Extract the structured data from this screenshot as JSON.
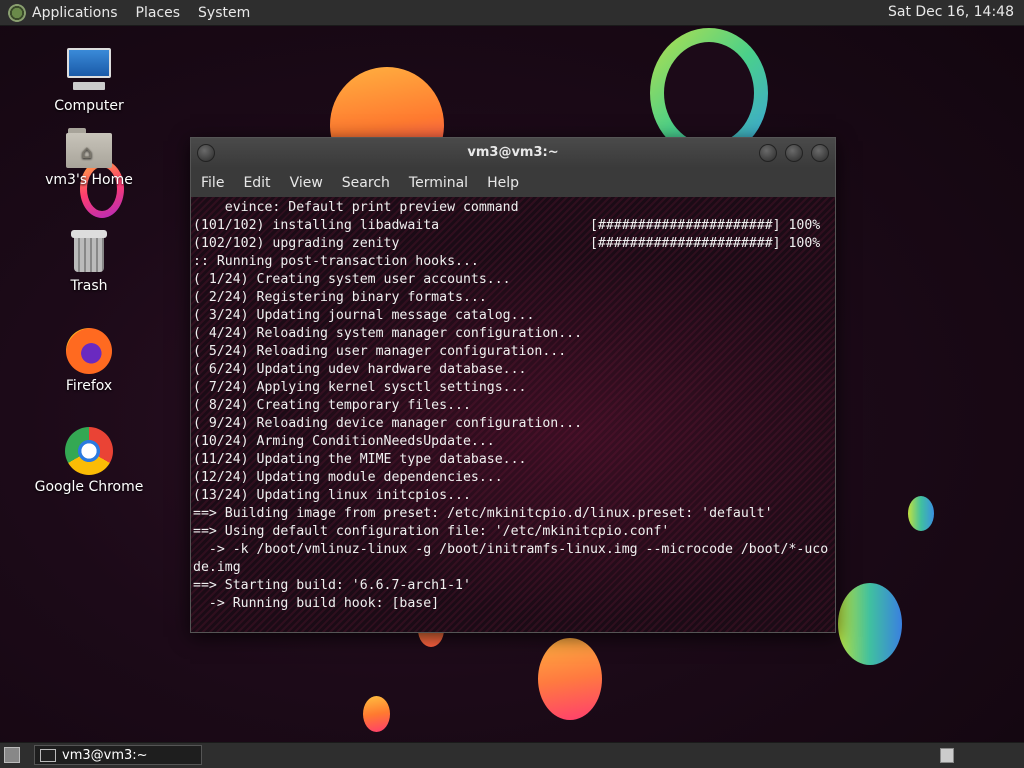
{
  "top_panel": {
    "menus": [
      "Applications",
      "Places",
      "System"
    ],
    "clock": "Sat Dec 16, 14:48"
  },
  "desktop_icons": [
    {
      "label": "Computer",
      "icon": "computer-icon"
    },
    {
      "label": "vm3's Home",
      "icon": "home-folder-icon"
    },
    {
      "label": "Trash",
      "icon": "trash-icon"
    },
    {
      "label": "Firefox",
      "icon": "firefox-icon"
    },
    {
      "label": "Google Chrome",
      "icon": "chrome-icon"
    }
  ],
  "terminal": {
    "title": "vm3@vm3:~",
    "menu": [
      "File",
      "Edit",
      "View",
      "Search",
      "Terminal",
      "Help"
    ],
    "lines": [
      "    evince: Default print preview command",
      "(101/102) installing libadwaita                   [######################] 100%",
      "(102/102) upgrading zenity                        [######################] 100%",
      ":: Running post-transaction hooks...",
      "( 1/24) Creating system user accounts...",
      "( 2/24) Registering binary formats...",
      "( 3/24) Updating journal message catalog...",
      "( 4/24) Reloading system manager configuration...",
      "( 5/24) Reloading user manager configuration...",
      "( 6/24) Updating udev hardware database...",
      "( 7/24) Applying kernel sysctl settings...",
      "( 8/24) Creating temporary files...",
      "( 9/24) Reloading device manager configuration...",
      "(10/24) Arming ConditionNeedsUpdate...",
      "(11/24) Updating the MIME type database...",
      "(12/24) Updating module dependencies...",
      "(13/24) Updating linux initcpios...",
      "==> Building image from preset: /etc/mkinitcpio.d/linux.preset: 'default'",
      "==> Using default configuration file: '/etc/mkinitcpio.conf'",
      "  -> -k /boot/vmlinuz-linux -g /boot/initramfs-linux.img --microcode /boot/*-uco",
      "de.img",
      "==> Starting build: '6.6.7-arch1-1'",
      "  -> Running build hook: [base]"
    ]
  },
  "taskbar": {
    "tasks": [
      {
        "label": "vm3@vm3:~"
      }
    ]
  }
}
